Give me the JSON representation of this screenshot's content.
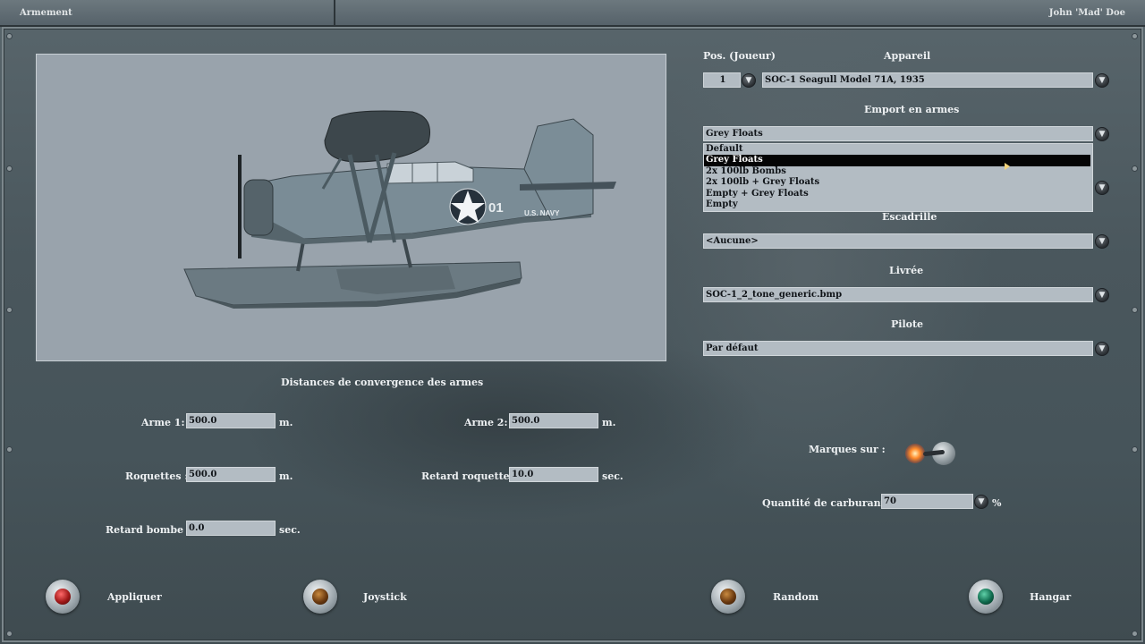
{
  "window": {
    "title": "Armement",
    "user": "John 'Mad' Doe"
  },
  "aircraft_panel": {
    "position_label": "Pos. (Joueur)",
    "aircraft_label": "Appareil",
    "position_value": "1",
    "aircraft_value": "SOC-1 Seagull Model 71A, 1935",
    "loadout_label": "Emport en armes",
    "loadout_value": "Grey Floats",
    "loadout_options": [
      "Default",
      "Grey Floats",
      "2x 100lb Bombs",
      "2x 100lb + Grey Floats",
      "Empty + Grey Floats",
      "Empty"
    ],
    "squadron_label": "Escadrille",
    "squadron_value": "<Aucune>",
    "skin_label": "Livrée",
    "skin_value": "SOC-1_2_tone_generic.bmp",
    "pilot_label": "Pilote",
    "pilot_value": "Par défaut",
    "markings_label": "Marques sur :",
    "markings_on": true,
    "fuel_label": "Quantité de carburant :",
    "fuel_value": "70",
    "fuel_unit": "%"
  },
  "preview": {
    "insignia_number": "01",
    "insignia_text": "U.S. NAVY"
  },
  "convergence": {
    "title": "Distances de convergence des armes",
    "weapon1_label": "Arme 1:",
    "weapon1_value": "500.0",
    "weapon2_label": "Arme 2:",
    "weapon2_value": "500.0",
    "rockets_label": "Roquettes :",
    "rockets_value": "500.0",
    "rocket_delay_label": "Retard roquette :",
    "rocket_delay_value": "10.0",
    "bomb_delay_label": "Retard bombe :",
    "bomb_delay_value": "0.0",
    "unit_m": "m.",
    "unit_sec": "sec."
  },
  "buttons": {
    "apply": "Appliquer",
    "joystick": "Joystick",
    "random": "Random",
    "hangar": "Hangar"
  },
  "colors": {
    "field_bg": "#b3bcc3",
    "selection_bg": "#050505",
    "apply_lamp": "#c01a1a",
    "hangar_lamp": "#0e6a4d"
  },
  "icons": {
    "dropdown": "chevron-down-icon",
    "markings_toggle": "toggle-switch-icon"
  }
}
